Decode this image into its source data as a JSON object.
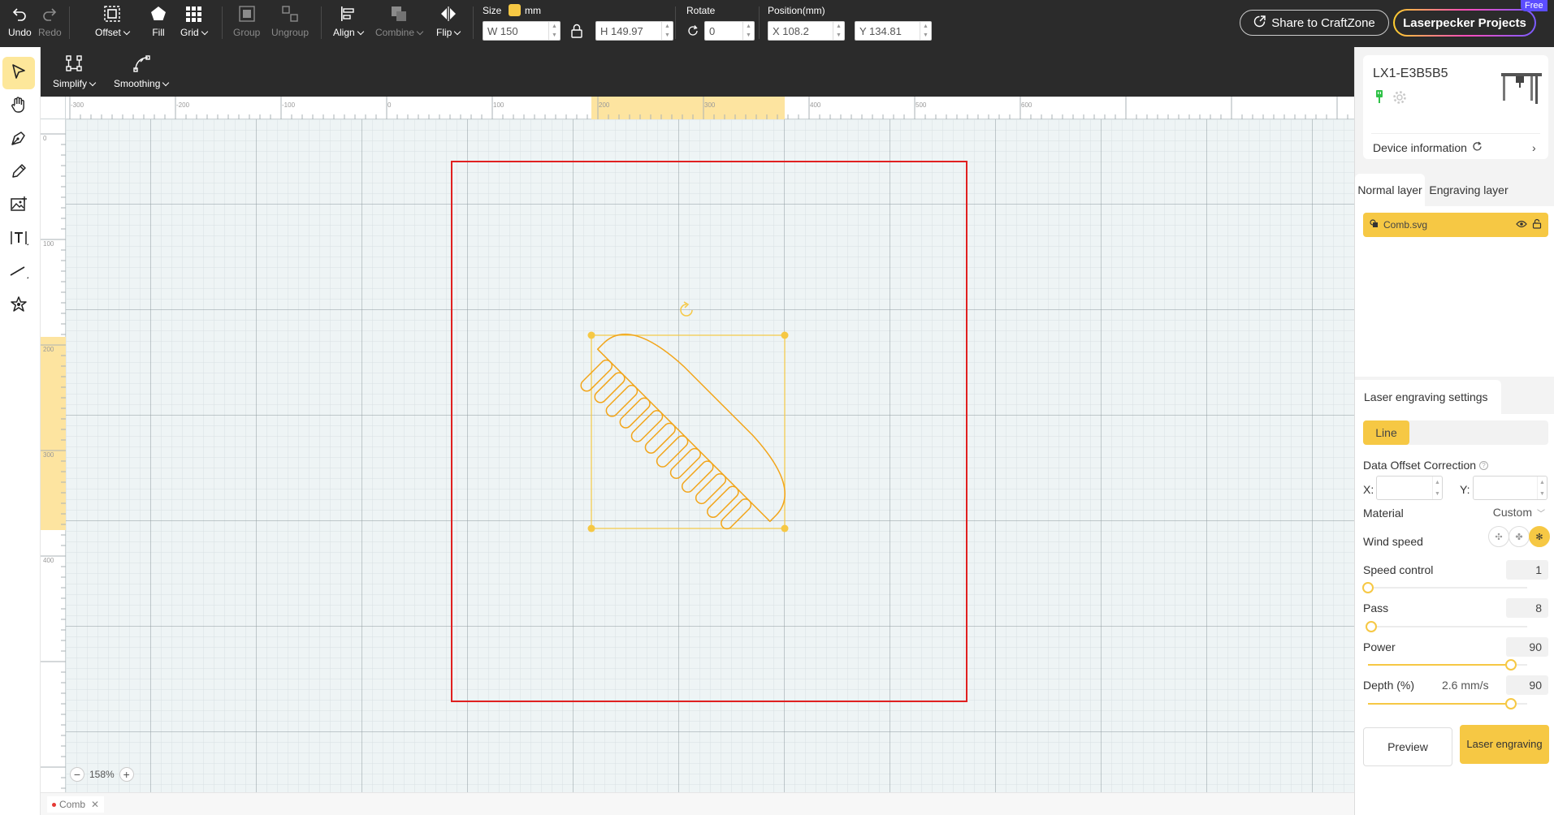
{
  "toolbar": {
    "undo": "Undo",
    "redo": "Redo",
    "offset": "Offset",
    "fill": "Fill",
    "grid": "Grid",
    "group": "Group",
    "ungroup": "Ungroup",
    "align": "Align",
    "combine": "Combine",
    "flip": "Flip",
    "size_label": "Size",
    "size_unit": "mm",
    "width": "W 150",
    "height": "H 149.97",
    "rotate_label": "Rotate",
    "rotate_value": "0",
    "position_label": "Position(mm)",
    "pos_x": "X 108.2",
    "pos_y": "Y 134.81",
    "share_label": "Share to CraftZone",
    "projects_label": "Laserpecker Projects",
    "free_tag": "Free"
  },
  "subtoolbar": {
    "simplify": "Simplify",
    "smoothing": "Smoothing"
  },
  "left_tools": [
    "select-icon",
    "hand-icon",
    "pen-icon",
    "pencil-icon",
    "image-icon",
    "text-icon",
    "line-icon",
    "shapes-icon"
  ],
  "canvas": {
    "ruler_top_labels": [
      "-300",
      "-200",
      "-100",
      "0",
      "100",
      "200",
      "300",
      "400",
      "500",
      "600"
    ],
    "ruler_left_labels": [
      "0",
      "100",
      "200",
      "300",
      "400"
    ],
    "zoom_level": "158%",
    "document_tab": "Comb"
  },
  "right_panel": {
    "device_name": "LX1-E3B5B5",
    "device_info_label": "Device information",
    "tabs": [
      "Normal layer",
      "Engraving layer"
    ],
    "active_tab": "Normal layer",
    "layers": [
      {
        "name": "Comb.svg"
      }
    ],
    "settings_title": "Laser engraving settings",
    "mode": "Line",
    "data_offset_label": "Data Offset Correction",
    "offset_x_label": "X:",
    "offset_y_label": "Y:",
    "material_label": "Material",
    "material_value": "Custom",
    "wind_speed_label": "Wind speed",
    "speed_control_label": "Speed control",
    "speed_control_value": "1",
    "speed_control_fraction": 0.0,
    "pass_label": "Pass",
    "pass_value": "8",
    "pass_fraction": 0.02,
    "power_label": "Power",
    "power_value": "90",
    "power_fraction": 0.9,
    "depth_label": "Depth (%)",
    "depth_speed": "2.6 mm/s",
    "depth_value": "90",
    "depth_fraction": 0.9,
    "preview_button": "Preview",
    "engrave_button": "Laser engraving"
  },
  "colors": {
    "accent": "#f6c844",
    "toolbar_bg": "#2b2b2b",
    "work_area_border": "#e02020",
    "selection": "#f2a51a"
  }
}
